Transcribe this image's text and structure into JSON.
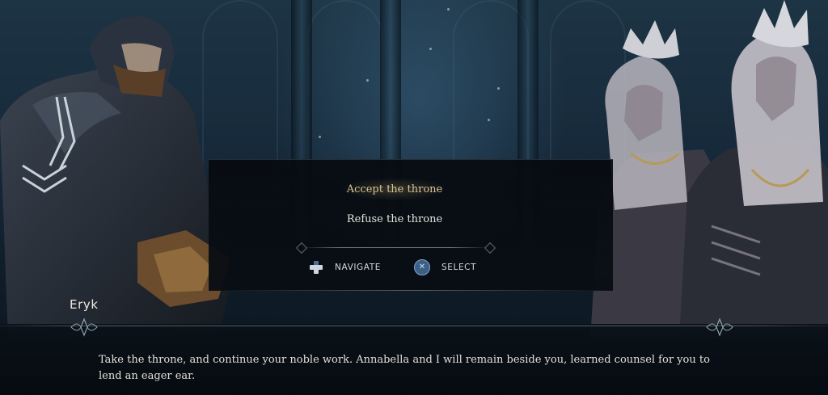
{
  "choices": [
    {
      "label": "Accept the throne",
      "selected": true
    },
    {
      "label": "Refuse the throne",
      "selected": false
    }
  ],
  "controls": {
    "navigate_label": "NAVIGATE",
    "navigate_icon": "dpad-icon",
    "select_label": "SELECT",
    "select_icon": "cross-button-icon"
  },
  "dialogue": {
    "speaker": "Eryk",
    "text": "Take the throne, and continue your noble work. Annabella and I will remain beside you, learned counsel for you to lend an eager ear."
  },
  "colors": {
    "selected_choice": "#d8c496",
    "text": "#e3dfd7",
    "cross_button": "#3c5f86"
  }
}
